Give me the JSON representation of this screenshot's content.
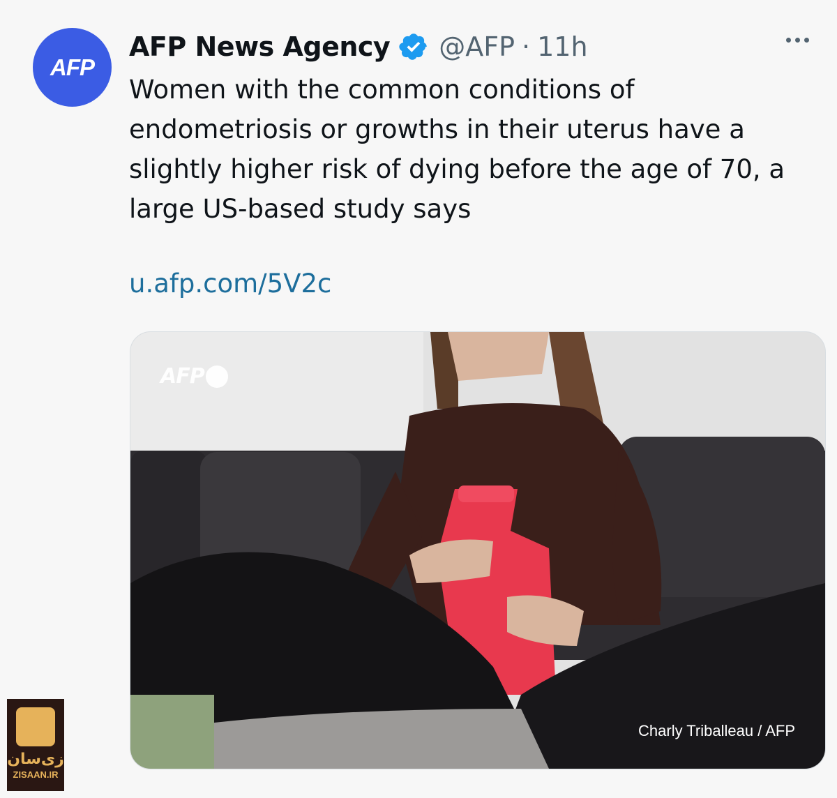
{
  "tweet": {
    "avatar_text": "AFP",
    "author_name": "AFP News Agency",
    "verified_icon": "verified-badge-icon",
    "handle": "@AFP",
    "separator": "·",
    "time": "11h",
    "text": "Women with the common conditions of endometriosis or growths in their uterus have a slightly higher risk of dying before the age of 70, a large US-based study says",
    "link": "u.afp.com/5V2c",
    "more_icon": "more-options-icon"
  },
  "media": {
    "watermark": "AFP",
    "credit": "Charly Triballeau / AFP"
  },
  "site_watermark": {
    "fa_text": "زی‌سان",
    "en_text": "ZISAAN.IR"
  },
  "colors": {
    "avatar_bg": "#3b5ce4",
    "verified": "#1d9bf0",
    "link": "#1d6e9c",
    "muted": "#536471"
  }
}
